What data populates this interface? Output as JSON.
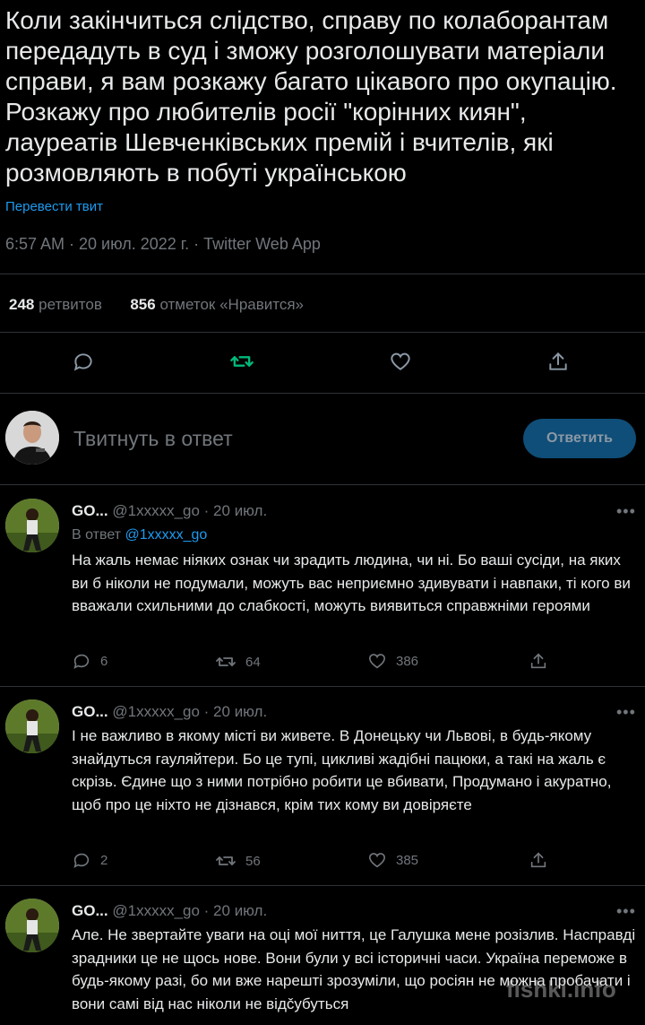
{
  "tweet": {
    "text": "Коли закінчиться слідство, справу по колаборантам передадуть в суд і зможу розголошувати матеріали справи, я вам розкажу  багато цікавого про окупацію. Розкажу про любителів росії \"корінних киян\", лауреатів Шевченківських премій і вчителів, які розмовляють в побуті українською",
    "translate": "Перевести твит",
    "meta": "6:57 AM · 20 июл. 2022 г. · Twitter Web App",
    "retweets_count": "248",
    "retweets_label": "ретвитов",
    "likes_count": "856",
    "likes_label": "отметок «Нравится»"
  },
  "reply_box": {
    "placeholder": "Твитнуть в ответ",
    "button_label": "Ответить"
  },
  "replies": [
    {
      "name": "GO...",
      "handle": "@1xxxxx_go",
      "date": "· 20 июл.",
      "replying_label": "В ответ",
      "replying_to": "@1xxxxx_go",
      "text": "На жаль немає ніяких ознак чи зрадить людина, чи ні. Бо ваші сусіди, на яких ви б ніколи не подумали, можуть вас неприємно здивувати і навпаки, ті кого ви вважали схильними до слабкості, можуть виявиться справжніми героями",
      "reply_count": "6",
      "retweet_count": "64",
      "like_count": "386"
    },
    {
      "name": "GO...",
      "handle": "@1xxxxx_go",
      "date": "· 20 июл.",
      "text": "І не важливо в якому місті ви живете. В Донецьку чи Львові, в будь-якому знайдуться гауляйтери. Бо це тупі, цикливі жадібні пацюки, а такі на жаль є скрізь. Єдине що з ними потрібно робити це вбивати, Продумано і акуратно, щоб про це ніхто не дізнався, крім тих кому ви довіряєте",
      "reply_count": "2",
      "retweet_count": "56",
      "like_count": "385"
    },
    {
      "name": "GO...",
      "handle": "@1xxxxx_go",
      "date": "· 20 июл.",
      "text": "Але. Не звертайте уваги на оці мої ниття, це Галушка мене розізлив. Насправді зрадники це не щось нове. Вони були у всі історичні часи. Україна переможе в будь-якому разі, бо ми вже нарешті зрозуміли, що росіян не можна пробачати і вони самі від нас ніколи не відčубуться"
    }
  ],
  "watermark": "fishki.info",
  "colors": {
    "accent": "#1d9bf0",
    "retweet_active": "#00ba7c",
    "muted": "#71767b"
  }
}
